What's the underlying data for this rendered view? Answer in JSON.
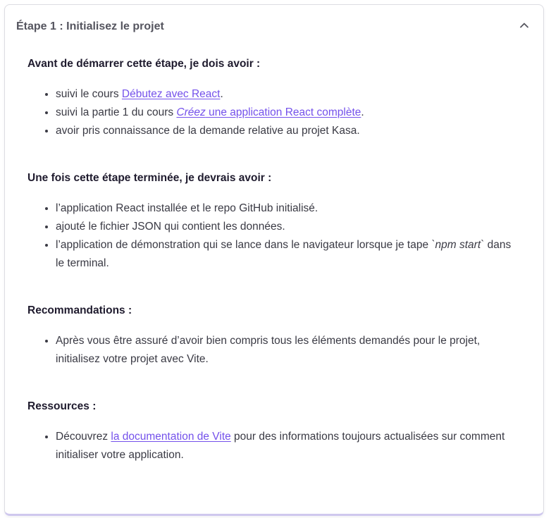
{
  "header": {
    "title": "Étape 1 : Initialisez le projet"
  },
  "sections": [
    {
      "title": "Avant de démarrer cette étape, je dois avoir :",
      "items": [
        {
          "before": "suivi le cours ",
          "link": "Débutez avec React",
          "after": "."
        },
        {
          "before": "suivi la partie 1 du cours ",
          "link_italic": "Créez",
          "link": " une application React complète",
          "after": "."
        },
        {
          "text": "avoir pris connaissance de la demande relative au projet Kasa."
        }
      ]
    },
    {
      "title": "Une fois cette étape terminée, je devrais avoir :",
      "items": [
        {
          "text": "l’application React installée et le repo GitHub initialisé."
        },
        {
          "text": "ajouté le fichier JSON qui contient les données."
        },
        {
          "before": "l’application de démonstration qui se lance dans le navigateur lorsque je tape ",
          "code": "`npm start`",
          "after": " dans le terminal."
        }
      ]
    },
    {
      "title": "Recommandations :",
      "items": [
        {
          "text": "Après vous être assuré d’avoir bien compris tous les éléments demandés pour le projet, initialisez votre projet avec Vite."
        }
      ]
    },
    {
      "title": "Ressources :",
      "items": [
        {
          "before": "Découvrez ",
          "link": "la documentation de Vite",
          "after": " pour des informations toujours actualisées sur comment initialiser votre application."
        }
      ]
    }
  ],
  "colors": {
    "link": "#7451eb",
    "title": "#1f1b2e",
    "header": "#55555f",
    "text": "#3a3a44"
  },
  "icons": {
    "collapse": "chevron-up-icon"
  }
}
